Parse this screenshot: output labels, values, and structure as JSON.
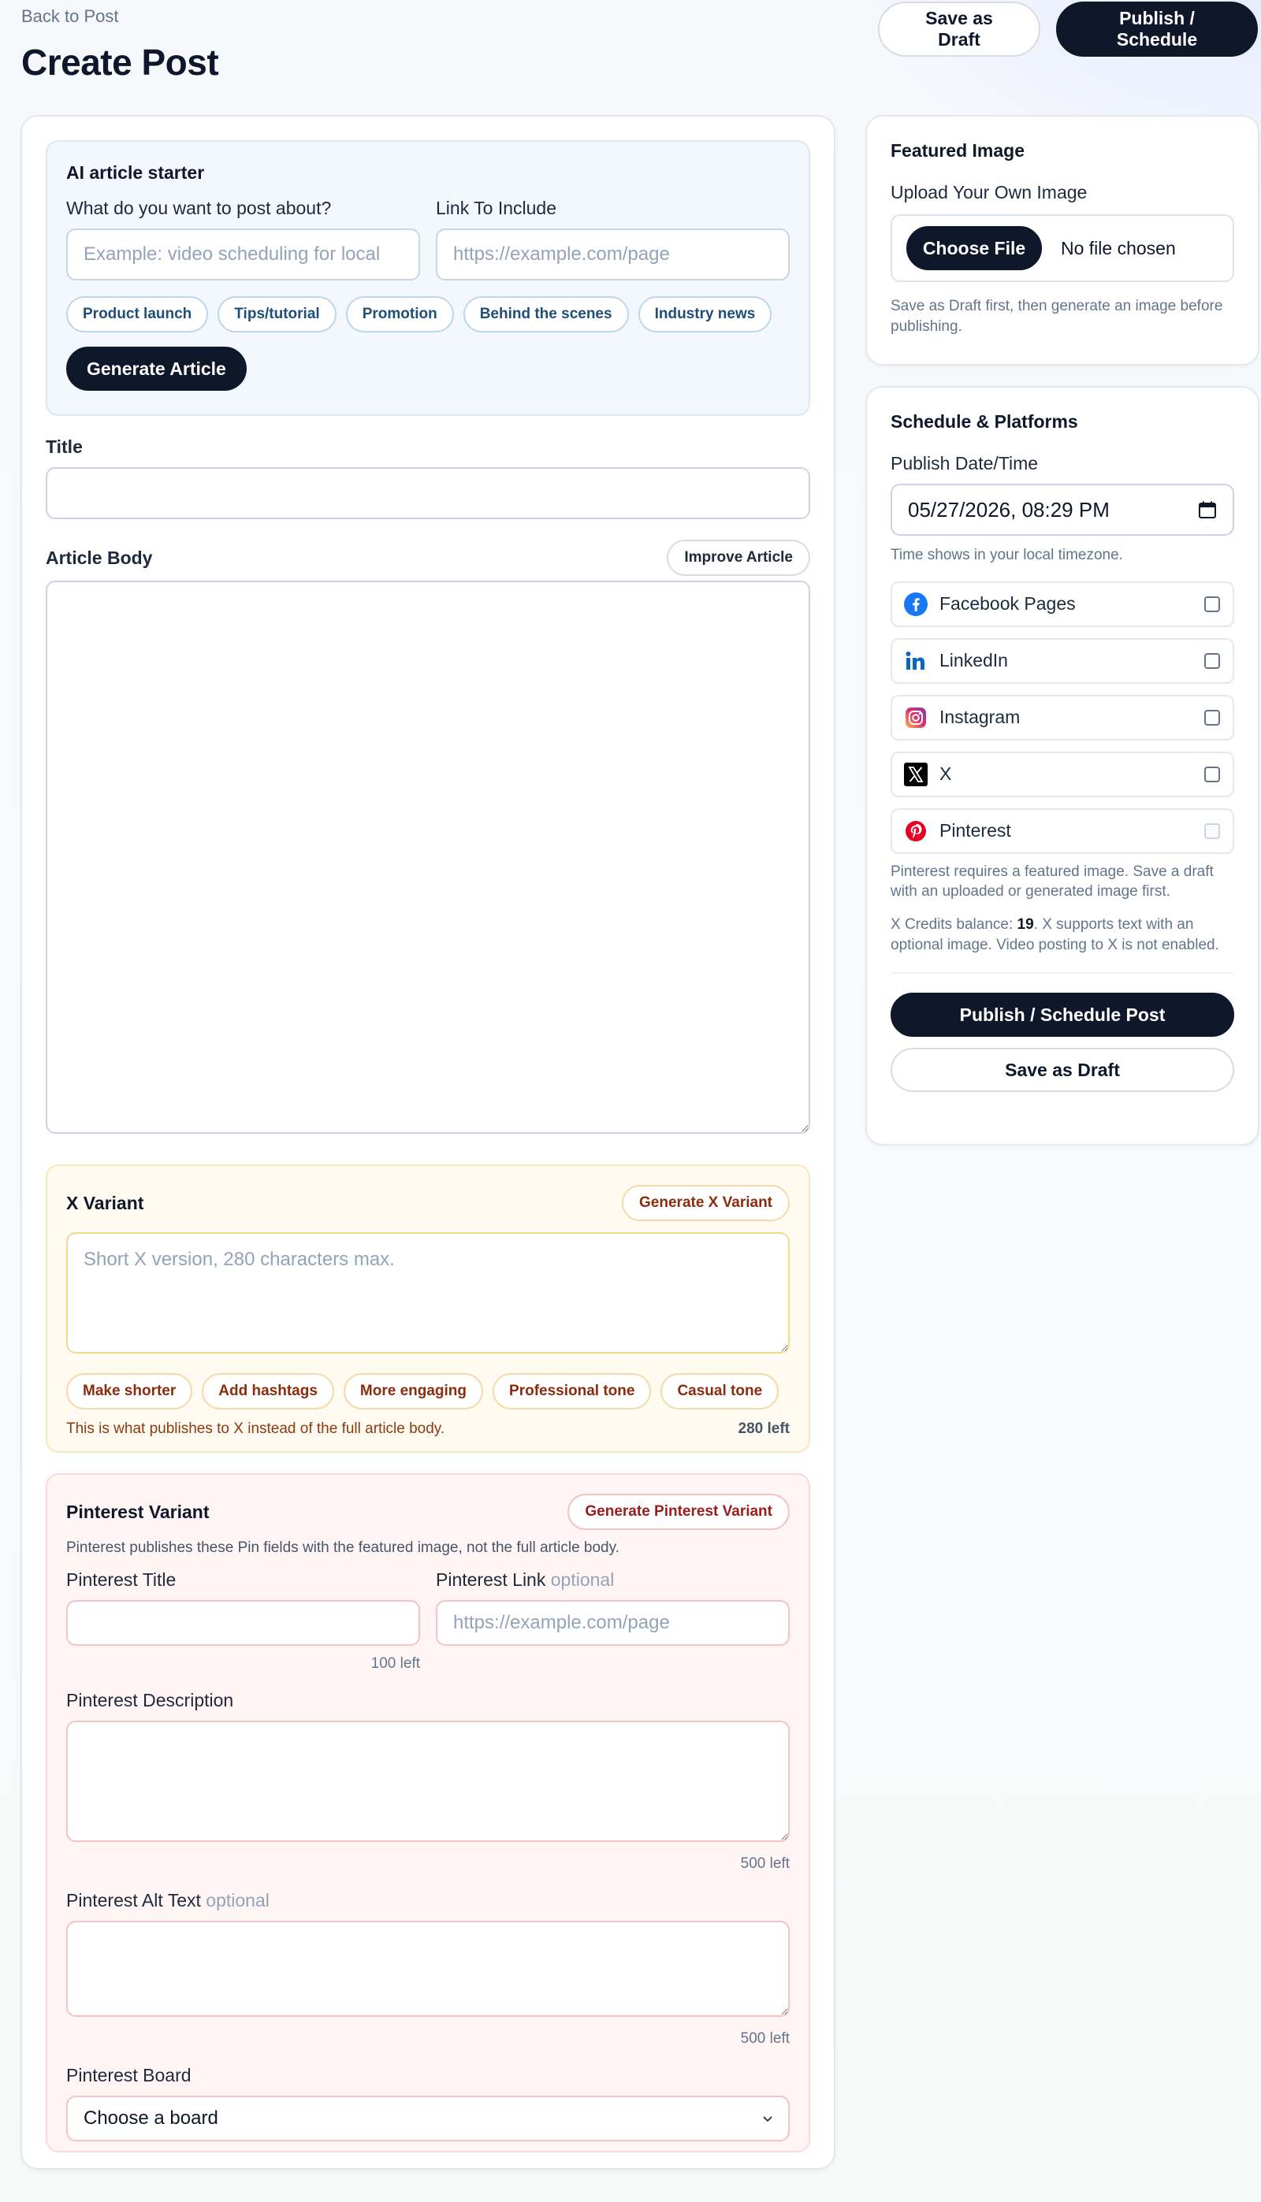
{
  "header": {
    "back_link": "Back to Post",
    "page_title": "Create Post",
    "save_draft": "Save as Draft",
    "publish": "Publish / Schedule"
  },
  "ai_starter": {
    "title": "AI article starter",
    "topic_label": "What do you want to post about?",
    "topic_placeholder": "Example: video scheduling for local",
    "link_label": "Link To Include",
    "link_placeholder": "https://example.com/page",
    "chips": [
      "Product launch",
      "Tips/tutorial",
      "Promotion",
      "Behind the scenes",
      "Industry news"
    ],
    "generate_button": "Generate Article"
  },
  "title_field": {
    "label": "Title",
    "value": ""
  },
  "article_body": {
    "label": "Article Body",
    "improve_button": "Improve Article",
    "value": ""
  },
  "x_variant": {
    "title": "X Variant",
    "generate_button": "Generate X Variant",
    "placeholder": "Short X version, 280 characters max.",
    "chips": [
      "Make shorter",
      "Add hashtags",
      "More engaging",
      "Professional tone",
      "Casual tone"
    ],
    "helper": "This is what publishes to X instead of the full article body.",
    "count": "280 left"
  },
  "pinterest_variant": {
    "title": "Pinterest Variant",
    "generate_button": "Generate Pinterest Variant",
    "description": "Pinterest publishes these Pin fields with the featured image, not the full article body.",
    "title_label": "Pinterest Title",
    "title_count": "100 left",
    "link_label": "Pinterest Link",
    "link_optional": "optional",
    "link_placeholder": "https://example.com/page",
    "desc_label": "Pinterest Description",
    "desc_count": "500 left",
    "alt_label": "Pinterest Alt Text",
    "alt_optional": "optional",
    "alt_count": "500 left",
    "board_label": "Pinterest Board",
    "board_selected": "Choose a board"
  },
  "featured_image": {
    "title": "Featured Image",
    "upload_label": "Upload Your Own Image",
    "choose_button": "Choose File",
    "file_status": "No file chosen",
    "hint": "Save as Draft first, then generate an image before publishing."
  },
  "schedule": {
    "title": "Schedule & Platforms",
    "date_label": "Publish Date/Time",
    "date_value": "05/27/2026, 08:29 PM",
    "timezone_hint": "Time shows in your local timezone.",
    "platforms": [
      {
        "name": "Facebook Pages",
        "icon": "facebook-icon",
        "checked": false,
        "disabled": false
      },
      {
        "name": "LinkedIn",
        "icon": "linkedin-icon",
        "checked": false,
        "disabled": false
      },
      {
        "name": "Instagram",
        "icon": "instagram-icon",
        "checked": false,
        "disabled": false
      },
      {
        "name": "X",
        "icon": "x-icon",
        "checked": false,
        "disabled": false
      },
      {
        "name": "Pinterest",
        "icon": "pinterest-icon",
        "checked": false,
        "disabled": true
      }
    ],
    "pinterest_note": "Pinterest requires a featured image. Save a draft with an uploaded or generated image first.",
    "credits_prefix": "X Credits balance: ",
    "credits_value": "19",
    "credits_suffix": ". X supports text with an optional image. Video posting to X is not enabled.",
    "publish_button": "Publish / Schedule Post",
    "draft_button": "Save as Draft"
  },
  "colors": {
    "primary_dark": "#0f172a",
    "facebook": "#1877f2",
    "linkedin": "#0a66c2",
    "pinterest": "#e60023",
    "x": "#000000"
  }
}
